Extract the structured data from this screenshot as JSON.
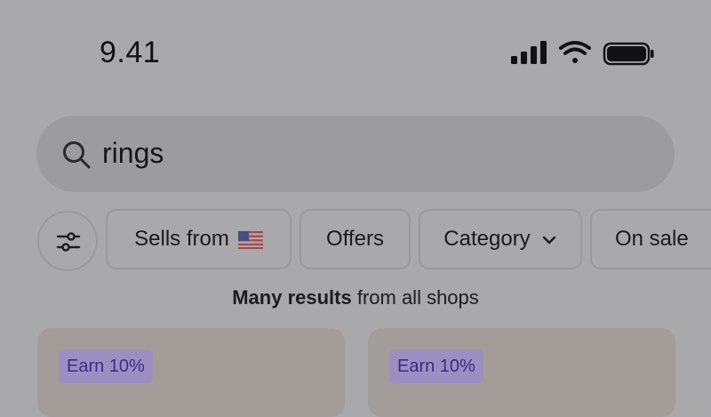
{
  "status_bar": {
    "time": "9.41",
    "icons": [
      "cellular-signal-icon",
      "wifi-icon",
      "battery-icon"
    ]
  },
  "search": {
    "icon": "search-icon",
    "value": "rings"
  },
  "filters": {
    "settings_icon": "sliders-icon",
    "chips": [
      {
        "label": "Sells from",
        "icon": "us-flag-icon"
      },
      {
        "label": "Offers"
      },
      {
        "label": "Category",
        "icon": "chevron-down-icon"
      },
      {
        "label": "On sale"
      }
    ]
  },
  "results": {
    "bold": "Many results",
    "rest": " from all shops"
  },
  "cards": [
    {
      "badge": "Earn 10%"
    },
    {
      "badge": "Earn 10%"
    }
  ],
  "colors": {
    "background": "#a9a8ab",
    "badge_bg": "#9b8fc2",
    "badge_text": "#3b2b87"
  }
}
